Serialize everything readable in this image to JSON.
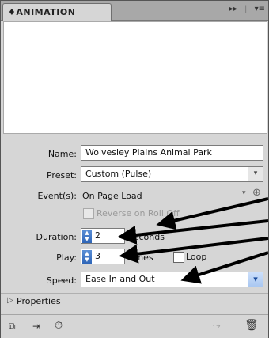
{
  "panel": {
    "tab_label": "ANIMATION",
    "tab_prefix": "♦",
    "fast_forward_icon": "▸▸",
    "separator": "|",
    "menu_icon": "▾≡"
  },
  "form": {
    "name_label": "Name:",
    "name_value": "Wolvesley Plains Animal Park",
    "preset_label": "Preset:",
    "preset_value": "Custom (Pulse)",
    "events_label": "Event(s):",
    "events_value": "On Page Load",
    "reverse_label": "Reverse on Roll Off",
    "duration_label": "Duration:",
    "duration_value": "2",
    "duration_unit": "seconds",
    "play_label": "Play:",
    "play_value": "3",
    "play_unit": "times",
    "loop_label": "Loop",
    "speed_label": "Speed:",
    "speed_value": "Ease In and Out",
    "properties_label": "Properties"
  }
}
